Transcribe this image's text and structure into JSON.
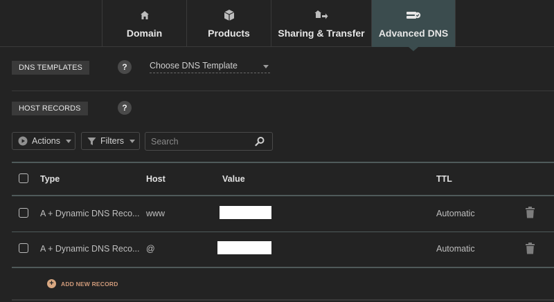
{
  "tabs": [
    {
      "label": "Domain",
      "icon": "home-icon"
    },
    {
      "label": "Products",
      "icon": "box-icon"
    },
    {
      "label": "Sharing & Transfer",
      "icon": "share-transfer-icon"
    },
    {
      "label": "Advanced DNS",
      "icon": "server-icon",
      "active": true
    }
  ],
  "dns_templates": {
    "label": "DNS TEMPLATES",
    "help": "?",
    "select_value": "Choose DNS Template"
  },
  "host_records": {
    "label": "HOST RECORDS",
    "help": "?"
  },
  "toolbar": {
    "actions_label": "Actions",
    "filters_label": "Filters",
    "search_placeholder": "Search"
  },
  "table": {
    "headers": {
      "type": "Type",
      "host": "Host",
      "value": "Value",
      "ttl": "TTL"
    },
    "rows": [
      {
        "type": "A + Dynamic DNS Reco...",
        "host": "www",
        "value": "",
        "ttl": "Automatic"
      },
      {
        "type": "A + Dynamic DNS Reco...",
        "host": "@",
        "value": "",
        "ttl": "Automatic"
      }
    ]
  },
  "add_record_label": "ADD NEW RECORD",
  "colors": {
    "background": "#232323",
    "active_tab": "#3b4c4e",
    "accent_add": "#d9a882"
  }
}
